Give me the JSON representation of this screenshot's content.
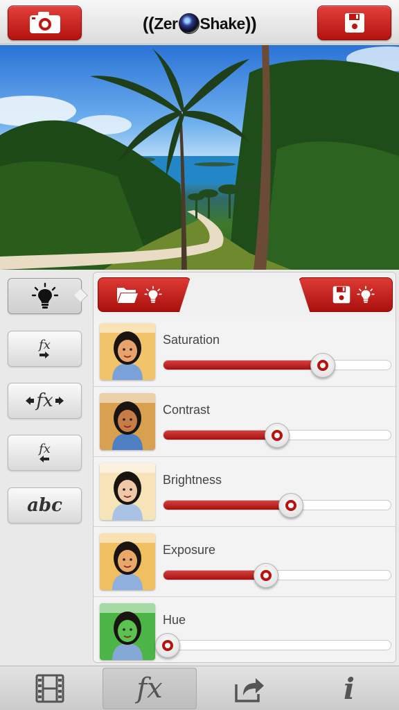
{
  "app": {
    "logo_left": "Zer",
    "logo_right": "Shake"
  },
  "header": {
    "camera_button": "camera-icon",
    "save_button": "save-icon"
  },
  "tools": [
    {
      "name": "lightbulb-icon",
      "active": true
    },
    {
      "label": "fx",
      "name": "fx-forward-icon"
    },
    {
      "label": "fx",
      "name": "fx-both-icon"
    },
    {
      "label": "fx",
      "name": "fx-back-icon"
    },
    {
      "label": "abc",
      "name": "text-tool"
    }
  ],
  "panel_tabs": {
    "load": "folder-lightbulb-icon",
    "save": "save-lightbulb-icon"
  },
  "adjustments": [
    {
      "label": "Saturation",
      "value": 0.7
    },
    {
      "label": "Contrast",
      "value": 0.5
    },
    {
      "label": "Brightness",
      "value": 0.56
    },
    {
      "label": "Exposure",
      "value": 0.45
    },
    {
      "label": "Hue",
      "value": 0.02
    }
  ],
  "bottom_tabs": [
    {
      "name": "film-icon"
    },
    {
      "label": "fx",
      "name": "fx-icon",
      "active": true
    },
    {
      "name": "share-icon"
    },
    {
      "label": "i",
      "name": "info-icon"
    }
  ],
  "colors": {
    "accent": "#b3120f",
    "accent_light": "#e2403a"
  }
}
